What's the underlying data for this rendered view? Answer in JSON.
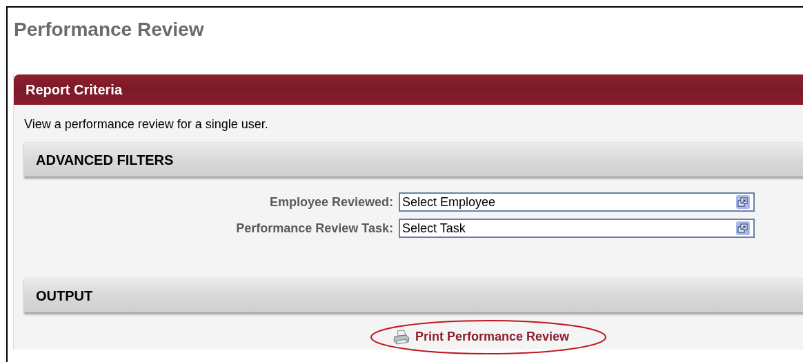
{
  "page_title": "Performance Review",
  "panel": {
    "title": "Report Criteria",
    "description": "View a performance review for a single user.",
    "sections": [
      {
        "kind": "filters",
        "title": "ADVANCED FILTERS",
        "fields": [
          {
            "label": "Employee Reviewed:",
            "value": "Select Employee"
          },
          {
            "label": "Performance Review Task:",
            "value": "Select Task"
          }
        ]
      },
      {
        "kind": "output",
        "title": "OUTPUT",
        "link": {
          "label": "Print Performance Review",
          "highlighted": true
        }
      }
    ]
  }
}
